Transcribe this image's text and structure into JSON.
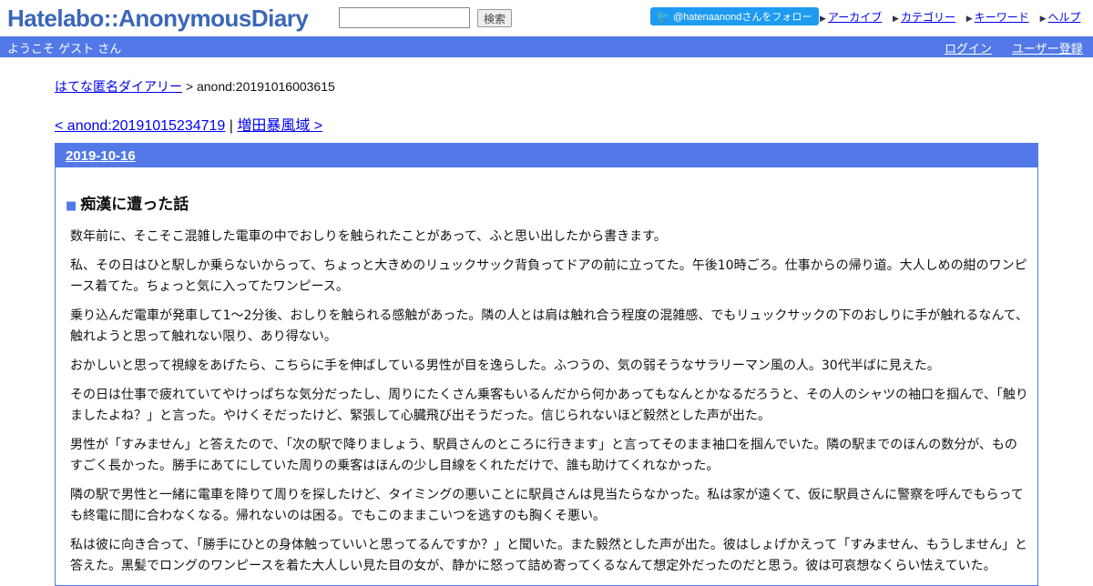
{
  "header": {
    "logo": "Hatelabo::AnonymousDiary",
    "search_value": "",
    "search_button": "検索",
    "follow_button": "@hatenaanondさんをフォロー",
    "nav": [
      "アーカイブ",
      "カテゴリー",
      "キーワード",
      "ヘルプ"
    ]
  },
  "welcome": {
    "text": "ようこそ ゲスト さん",
    "login": "ログイン",
    "register": "ユーザー登録"
  },
  "breadcrumb": {
    "home": "はてな匿名ダイアリー",
    "separator": " > ",
    "current": "anond:20191016003615"
  },
  "pager": {
    "prev": "< anond:20191015234719",
    "separator": " | ",
    "next": "増田暴風域 >"
  },
  "day": {
    "date": "2019-10-16"
  },
  "entry": {
    "title": "痴漢に遭った話",
    "paragraphs": [
      "数年前に、そこそこ混雑した電車の中でおしりを触られたことがあって、ふと思い出したから書きます。",
      "私、その日はひと駅しか乗らないからって、ちょっと大きめのリュックサック背負ってドアの前に立ってた。午後10時ごろ。仕事からの帰り道。大人しめの紺のワンピース着てた。ちょっと気に入ってたワンピース。",
      "乗り込んだ電車が発車して1〜2分後、おしりを触られる感触があった。隣の人とは肩は触れ合う程度の混雑感、でもリュックサックの下のおしりに手が触れるなんて、触れようと思って触れない限り、あり得ない。",
      "おかしいと思って視線をあげたら、こちらに手を伸ばしている男性が目を逸らした。ふつうの、気の弱そうなサラリーマン風の人。30代半ばに見えた。",
      "その日は仕事で疲れていてやけっぱちな気分だったし、周りにたくさん乗客もいるんだから何かあってもなんとかなるだろうと、その人のシャツの袖口を掴んで、「触りましたよね？」と言った。やけくそだったけど、緊張して心臓飛び出そうだった。信じられないほど毅然とした声が出た。",
      "男性が「すみません」と答えたので、「次の駅で降りましょう、駅員さんのところに行きます」と言ってそのまま袖口を掴んでいた。隣の駅までのほんの数分が、ものすごく長かった。勝手にあてにしていた周りの乗客はほんの少し目線をくれただけで、誰も助けてくれなかった。",
      "隣の駅で男性と一緒に電車を降りて周りを探したけど、タイミングの悪いことに駅員さんは見当たらなかった。私は家が遠くて、仮に駅員さんに警察を呼んでもらっても終電に間に合わなくなる。帰れないのは困る。でもこのままこいつを逃すのも胸くそ悪い。",
      "私は彼に向き合って、「勝手にひとの身体触っていいと思ってるんですか？」と聞いた。また毅然とした声が出た。彼はしょげかえって「すみません、もうしません」と答えた。黒髪でロングのワンピースを着た大人しい見た目の女が、静かに怒って詰め寄ってくるなんて想定外だったのだと思う。彼は可哀想なくらい怯えていた。"
    ]
  }
}
